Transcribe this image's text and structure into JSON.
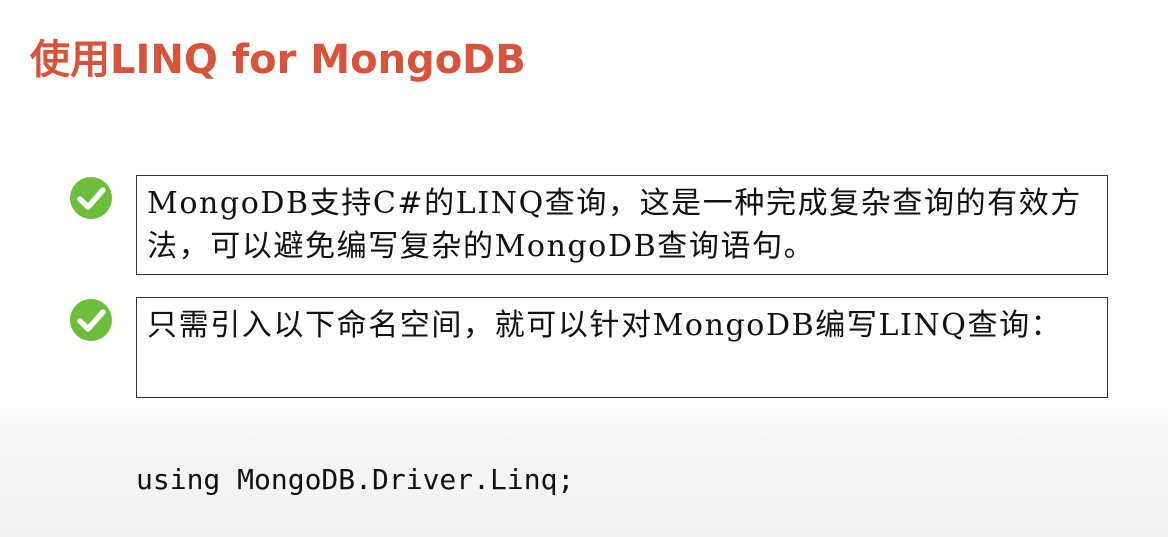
{
  "slide": {
    "title": "使用LINQ for MongoDB",
    "bullets": [
      {
        "icon": "check-circle-icon",
        "text": "MongoDB支持C#的LINQ查询，这是一种完成复杂查询的有效方法，可以避免编写复杂的MongoDB查询语句。"
      },
      {
        "icon": "check-circle-icon",
        "text": "只需引入以下命名空间，就可以针对MongoDB编写LINQ查询："
      }
    ],
    "code": "using MongoDB.Driver.Linq;"
  },
  "colors": {
    "title": "#d9533b",
    "check_green": "#6cbd3a"
  }
}
